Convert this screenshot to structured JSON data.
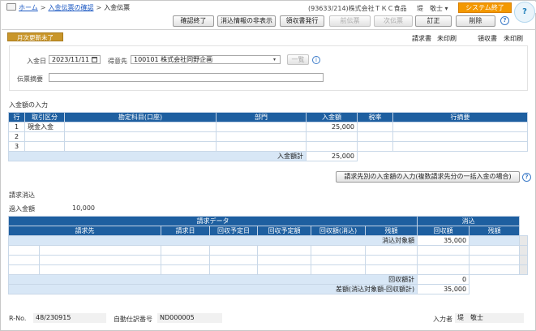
{
  "breadcrumb": {
    "home": "ホーム",
    "sep": ">",
    "parent": "入金伝票の確認",
    "current": "入金伝票"
  },
  "company": "(93633/214)株式会社ＴＫＣ食品",
  "user_name": "堤　敬士",
  "user_caret": "▾",
  "exit_label": "システム終了",
  "assistant_label": "?",
  "toolbar": {
    "confirm_end": "確認終了",
    "hide_reconcile": "消込情報の非表示",
    "issue_receipt": "領収書発行",
    "prev": "前伝票",
    "next": "次伝票",
    "correct": "訂正",
    "delete": "削除",
    "help": "?"
  },
  "status": {
    "badge": "月次更新未了",
    "invoice_label": "請求書",
    "invoice_value": "未印刷",
    "receipt_label": "領収書",
    "receipt_value": "未印刷"
  },
  "form": {
    "date_label": "入金日",
    "date_value": "2023/11/11",
    "customer_label": "得意先",
    "customer_value": "100101 株式会社同野企画",
    "list_button": "一覧",
    "info": "i",
    "memo_label": "伝票摘要",
    "memo_value": ""
  },
  "payment_section": {
    "title": "入金額の入力",
    "headers": [
      "行",
      "取引区分",
      "勘定科目(口座)",
      "部門",
      "入金額",
      "税率",
      "行摘要"
    ],
    "rows": [
      [
        "1",
        "現金入金",
        "",
        "",
        "25,000",
        "",
        ""
      ],
      [
        "2",
        "",
        "",
        "",
        "",
        "",
        ""
      ],
      [
        "3",
        "",
        "",
        "",
        "",
        "",
        ""
      ]
    ],
    "total_label": "入金額計",
    "total_value": "25,000",
    "bulk_button": "請求先別の入金額の入力(複数請求先分の一括入金の場合)",
    "help": "?"
  },
  "reconcile_section": {
    "title": "請求消込",
    "over_label": "過入金額",
    "over_value": "10,000",
    "group_invoice": "請求データ",
    "group_reconcile": "消込",
    "headers": [
      "請求先",
      "請求日",
      "回収予定日",
      "回収予定額",
      "回収額(消込)",
      "残額",
      "回収額",
      "残額"
    ],
    "target_label": "消込対象額",
    "target_value": "35,000",
    "collected_total_label": "回収額計",
    "collected_total_value": "0",
    "diff_label": "差額(消込対象額-回収額計)",
    "diff_value": "35,000"
  },
  "footer": {
    "rno_label": "R-No.",
    "rno_value": "48/230915",
    "auto_label": "自動仕訳番号",
    "auto_value": "ND000005",
    "entered_label": "入力者",
    "entered_value": "堤　敬士"
  }
}
